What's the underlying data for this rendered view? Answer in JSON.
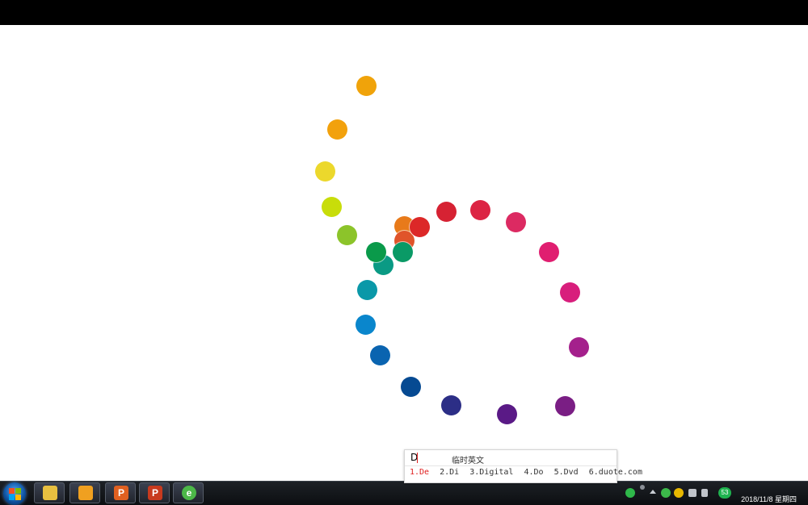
{
  "dots": [
    {
      "color": "#f0a30a"
    },
    {
      "color": "#f2a10c"
    },
    {
      "color": "#ecd82c"
    },
    {
      "color": "#c8dd0a"
    },
    {
      "color": "#8cc42a"
    },
    {
      "color": "#e87a1a"
    },
    {
      "color": "#e0542a"
    },
    {
      "color": "#dc2828"
    },
    {
      "color": "#d62233"
    },
    {
      "color": "#dc2443"
    },
    {
      "color": "#dc2a62"
    },
    {
      "color": "#e01e70"
    },
    {
      "color": "#d81e7c"
    },
    {
      "color": "#a4208c"
    },
    {
      "color": "#7a1e84"
    },
    {
      "color": "#5a1a86"
    },
    {
      "color": "#2c2e86"
    },
    {
      "color": "#064a92"
    },
    {
      "color": "#0a64b0"
    },
    {
      "color": "#0a86cc"
    },
    {
      "color": "#0a98a8"
    },
    {
      "color": "#0a9a84"
    },
    {
      "color": "#0a9a4a"
    },
    {
      "color": "#0a9a66"
    }
  ],
  "ime": {
    "input": "D",
    "mode": "临时英文",
    "candidates": [
      "1.De",
      "2.Di",
      "3.Digital",
      "4.Do",
      "5.Dvd",
      "6.duote.com"
    ],
    "accent": "#e02020"
  },
  "taskbar": {
    "apps": [
      {
        "icon": "file-explorer-icon",
        "color": "#e8c040"
      },
      {
        "icon": "image-viewer-icon",
        "color": "#f0a020"
      },
      {
        "icon": "wps-presentation-icon",
        "color": "#e06020",
        "glyph": "P"
      },
      {
        "icon": "powerpoint-icon",
        "color": "#c83a1e",
        "glyph": "P"
      },
      {
        "icon": "360-browser-icon",
        "color": "#4cb848",
        "glyph": "e"
      }
    ],
    "tray_badge": "53",
    "clock": "2018/11/8 星期四"
  }
}
